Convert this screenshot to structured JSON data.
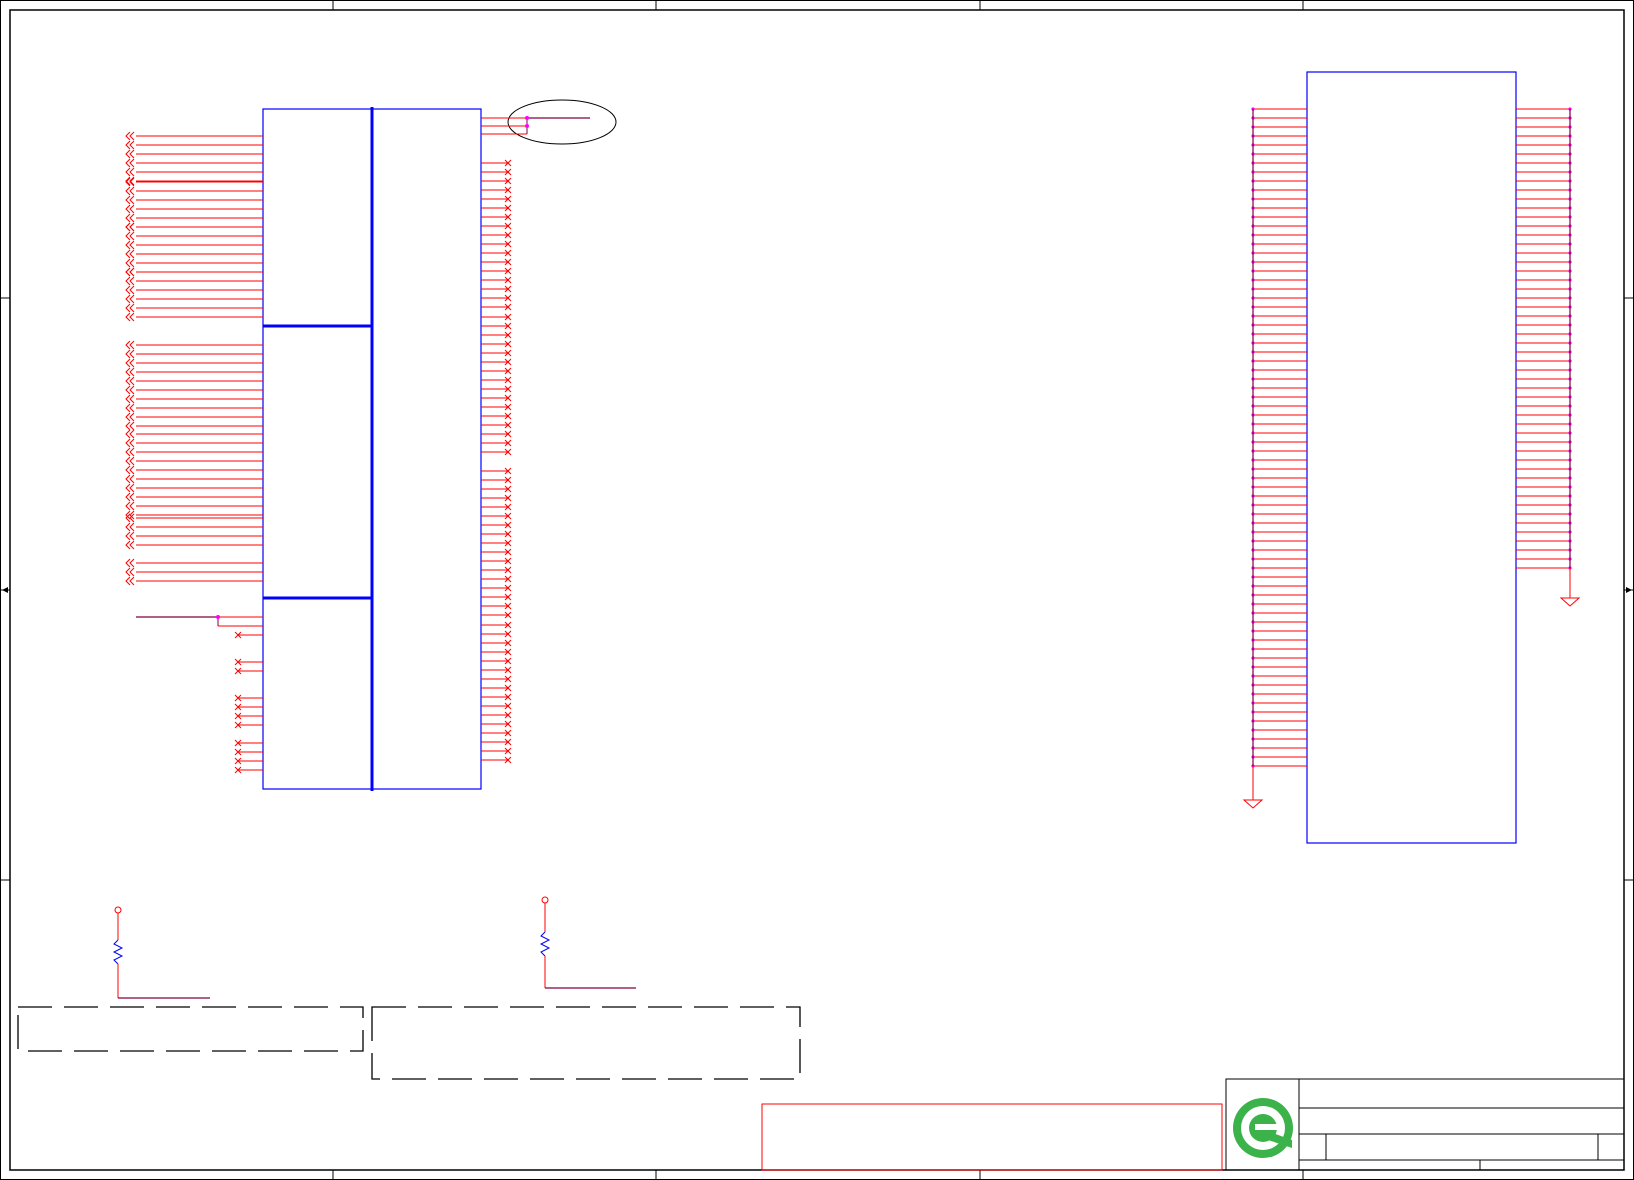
{
  "colors": {
    "frame": "#000000",
    "symbol_outline": "#0000ff",
    "wire": "#ff0000",
    "net": "#800040",
    "junction": "#ff00ff",
    "note_box": "#000000",
    "red_box": "#ff0000",
    "logo_green": "#3bb34a"
  },
  "sheet": {
    "zones": 5,
    "rows": 4
  },
  "main_connector": {
    "sections": 3,
    "left_pins": {
      "groups": [
        6,
        6,
        6,
        6,
        10,
        10,
        3,
        1,
        3
      ],
      "no_connect": true
    },
    "right_pins": {
      "no_connect": true
    },
    "highlight_circle": true
  },
  "right_connector": {
    "left_pin_count": 74,
    "right_pin_count": 52,
    "ground_symbols": 2
  },
  "pullups": {
    "count": 2,
    "resistor_symbol": "zigzag"
  },
  "note_boxes": {
    "count": 2,
    "style": "dashed"
  },
  "title_block": {
    "logo": "e-logo-icon"
  }
}
